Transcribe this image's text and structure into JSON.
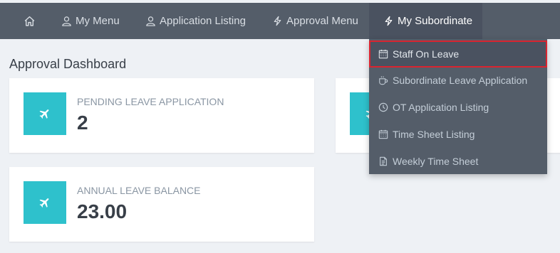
{
  "navbar": {
    "items": [
      {
        "label": "My Menu",
        "icon": "user-icon"
      },
      {
        "label": "Application Listing",
        "icon": "user-icon"
      },
      {
        "label": "Approval Menu",
        "icon": "bolt-icon"
      },
      {
        "label": "My Subordinate",
        "icon": "bolt-icon",
        "active": true
      }
    ]
  },
  "dropdown": {
    "items": [
      {
        "label": "Staff On Leave",
        "icon": "calendar-icon",
        "highlighted": true
      },
      {
        "label": "Subordinate Leave Application",
        "icon": "coffee-icon"
      },
      {
        "label": "OT Application Listing",
        "icon": "clock-icon"
      },
      {
        "label": "Time Sheet Listing",
        "icon": "calendar-icon"
      },
      {
        "label": "Weekly Time Sheet",
        "icon": "document-icon"
      }
    ]
  },
  "page": {
    "title": "Approval Dashboard"
  },
  "cards": [
    {
      "label": "PENDING LEAVE APPLICATION",
      "value": "2",
      "icon": "plane-icon"
    },
    {
      "label": "",
      "value": "",
      "icon": "plane-icon"
    },
    {
      "label": "ANNUAL LEAVE BALANCE",
      "value": "23.00",
      "icon": "plane-icon"
    }
  ],
  "colors": {
    "navbar": "#545d69",
    "active_nav": "#4a5260",
    "accent": "#2ec1cc",
    "highlight_border": "#d92430",
    "background": "#eef1f5"
  }
}
